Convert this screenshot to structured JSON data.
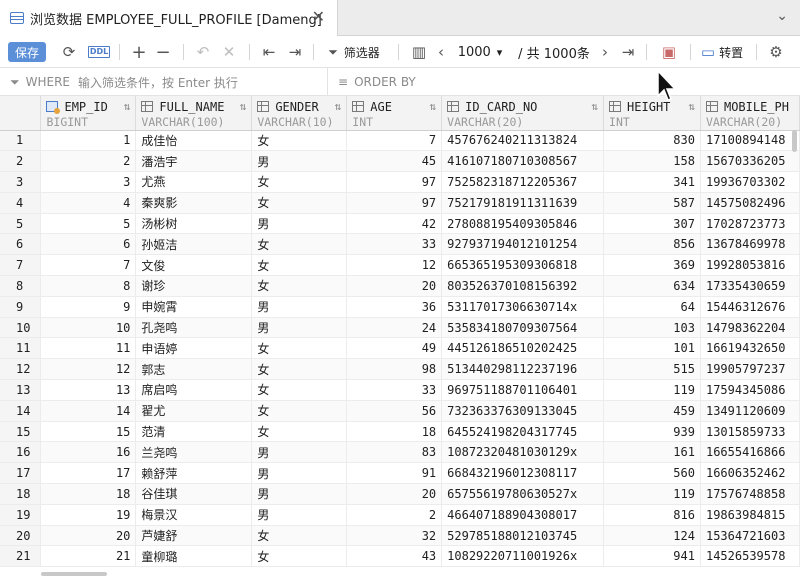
{
  "tab": {
    "title": "浏览数据 EMPLOYEE_FULL_PROFILE [Dameng]",
    "close": "✕"
  },
  "toolbar": {
    "save_label": "保存",
    "ddl_label": "DDL",
    "filter_label": "筛选器",
    "page_size": "1000",
    "total_label": "/ 共 1000条",
    "transpose_label": "转置"
  },
  "filter": {
    "where_label": "WHERE",
    "where_placeholder": "输入筛选条件，按 Enter 执行",
    "order_label": "ORDER BY"
  },
  "columns": [
    {
      "name": "EMP_ID",
      "type": "BIGINT",
      "key": true
    },
    {
      "name": "FULL_NAME",
      "type": "VARCHAR(100)"
    },
    {
      "name": "GENDER",
      "type": "VARCHAR(10)"
    },
    {
      "name": "AGE",
      "type": "INT"
    },
    {
      "name": "ID_CARD_NO",
      "type": "VARCHAR(20)"
    },
    {
      "name": "HEIGHT",
      "type": "INT"
    },
    {
      "name": "MOBILE_PH",
      "type": "VARCHAR(20)"
    }
  ],
  "rows": [
    [
      "1",
      "1",
      "成佳怡",
      "女",
      "7",
      "457676240211313824",
      "830",
      "17100894148"
    ],
    [
      "2",
      "2",
      "潘浩宇",
      "男",
      "45",
      "416107180710308567",
      "158",
      "15670336205"
    ],
    [
      "3",
      "3",
      "尤燕",
      "女",
      "97",
      "752582318712205367",
      "341",
      "19936703302"
    ],
    [
      "4",
      "4",
      "秦爽影",
      "女",
      "97",
      "752179181911311639",
      "587",
      "14575082496"
    ],
    [
      "5",
      "5",
      "汤彬树",
      "男",
      "42",
      "278088195409305846",
      "307",
      "17028723773"
    ],
    [
      "6",
      "6",
      "孙姬洁",
      "女",
      "33",
      "927937194012101254",
      "856",
      "13678469978"
    ],
    [
      "7",
      "7",
      "文俊",
      "女",
      "12",
      "665365195309306818",
      "369",
      "19928053816"
    ],
    [
      "8",
      "8",
      "谢珍",
      "女",
      "20",
      "803526370108156392",
      "634",
      "17335430659"
    ],
    [
      "9",
      "9",
      "申婉霄",
      "男",
      "36",
      "53117017306630714x",
      "64",
      "15446312676"
    ],
    [
      "10",
      "10",
      "孔尧鸣",
      "男",
      "24",
      "535834180709307564",
      "103",
      "14798362204"
    ],
    [
      "11",
      "11",
      "申语婷",
      "女",
      "49",
      "445126186510202425",
      "101",
      "16619432650"
    ],
    [
      "12",
      "12",
      "郭志",
      "女",
      "98",
      "513440298112237196",
      "515",
      "19905797237"
    ],
    [
      "13",
      "13",
      "席启鸣",
      "女",
      "33",
      "969751188701106401",
      "119",
      "17594345086"
    ],
    [
      "14",
      "14",
      "翟尤",
      "女",
      "56",
      "732363376309133045",
      "459",
      "13491120609"
    ],
    [
      "15",
      "15",
      "范清",
      "女",
      "18",
      "645524198204317745",
      "939",
      "13015859733"
    ],
    [
      "16",
      "16",
      "兰尧鸣",
      "男",
      "83",
      "10872320481030129x",
      "161",
      "16655416866"
    ],
    [
      "17",
      "17",
      "赖舒萍",
      "男",
      "91",
      "668432196012308117",
      "560",
      "16606352462"
    ],
    [
      "18",
      "18",
      "谷佳琪",
      "男",
      "20",
      "65755619780630527x",
      "119",
      "17576748858"
    ],
    [
      "19",
      "19",
      "梅景汉",
      "男",
      "2",
      "466407188904308017",
      "816",
      "19863984815"
    ],
    [
      "20",
      "20",
      "芦婕舒",
      "女",
      "32",
      "529785188012103745",
      "124",
      "15364721603"
    ],
    [
      "21",
      "21",
      "童柳璐",
      "女",
      "43",
      "10829220711001926x",
      "941",
      "14526539578"
    ]
  ]
}
